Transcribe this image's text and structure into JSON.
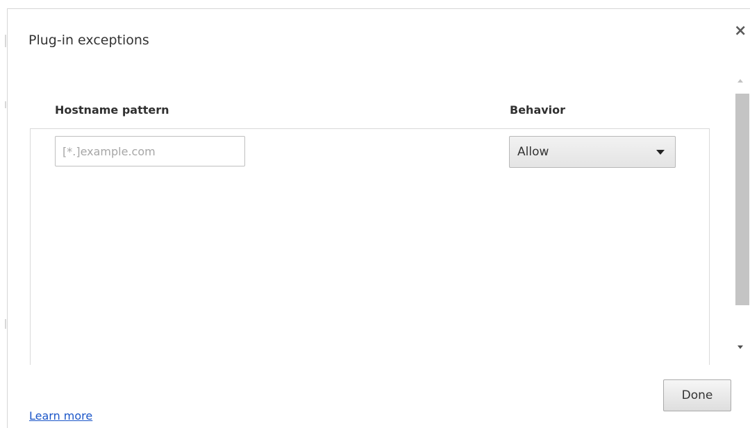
{
  "dialog": {
    "title": "Plug-in exceptions",
    "close_glyph": "×"
  },
  "table": {
    "columns": [
      "Hostname pattern",
      "Behavior"
    ],
    "new_row": {
      "hostname_placeholder": "[*.]example.com",
      "hostname_value": "",
      "behavior_selected": "Allow"
    }
  },
  "footer": {
    "learn_more": "Learn more",
    "done_label": "Done"
  },
  "colors": {
    "link": "#1a55c8",
    "scroll_thumb": "#c4c4c4"
  }
}
